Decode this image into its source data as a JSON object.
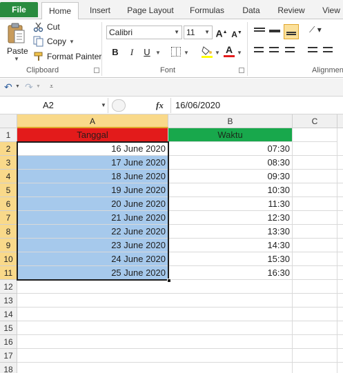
{
  "ribbon_tabs": [
    "File",
    "Home",
    "Insert",
    "Page Layout",
    "Formulas",
    "Data",
    "Review",
    "View"
  ],
  "clipboard": {
    "paste": "Paste",
    "cut": "Cut",
    "copy": "Copy",
    "format_painter": "Format Painter",
    "group_label": "Clipboard"
  },
  "font": {
    "family": "Calibri",
    "size": "11",
    "bold": "B",
    "italic": "I",
    "underline": "U",
    "group_label": "Font"
  },
  "alignment": {
    "group_label": "Alignmen"
  },
  "formula_bar": {
    "name_box": "A2",
    "fx": "fx",
    "value": "16/06/2020"
  },
  "columns": [
    "A",
    "B",
    "C"
  ],
  "rows": [
    "1",
    "2",
    "3",
    "4",
    "5",
    "6",
    "7",
    "8",
    "9",
    "10",
    "11",
    "12",
    "13",
    "14",
    "15",
    "16",
    "17",
    "18"
  ],
  "headers": {
    "tanggal": "Tanggal",
    "waktu": "Waktu"
  },
  "dates": [
    "16 June 2020",
    "17 June 2020",
    "18 June 2020",
    "19 June 2020",
    "20 June 2020",
    "21 June 2020",
    "22 June 2020",
    "23 June 2020",
    "24 June 2020",
    "25 June 2020"
  ],
  "times": [
    "07:30",
    "08:30",
    "09:30",
    "10:30",
    "11:30",
    "12:30",
    "13:30",
    "14:30",
    "15:30",
    "16:30"
  ],
  "colors": {
    "file_tab": "#2a8b3f",
    "header_red": "#e31b1b",
    "header_green": "#18a84c",
    "selection_fill": "#a6c9ec"
  }
}
